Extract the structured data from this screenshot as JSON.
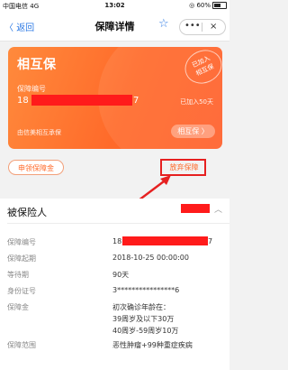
{
  "status": {
    "carrier": "中国电信",
    "network": "4G",
    "time": "13:02",
    "battery_pct": "60%"
  },
  "nav": {
    "back": "返回",
    "title": "保障详情",
    "more": "•••",
    "close": "×"
  },
  "card": {
    "brand": "相互保",
    "stamp": [
      "已加入",
      "相互保"
    ],
    "policy_label": "保障编号",
    "policy_prefix": "18",
    "policy_suffix": "7",
    "joined": "已加入50天",
    "underwriter": "由信美相互承保",
    "button": "相互保 〉"
  },
  "actions": {
    "claim": "申领保障金",
    "give_up": "放弃保障"
  },
  "insured": {
    "title": "被保险人",
    "rows": [
      {
        "label": "保障编号",
        "value_prefix": "18",
        "value_suffix": "7"
      },
      {
        "label": "保障起期",
        "value": "2018-10-25 00:00:00"
      },
      {
        "label": "等待期",
        "value": "90天"
      },
      {
        "label": "身份证号",
        "value": "3****************6"
      },
      {
        "label": "保障金",
        "value_lines": [
          "初次确诊年龄在：",
          "39周岁及以下30万",
          "40周岁-59周岁10万"
        ]
      },
      {
        "label": "保障范围",
        "value": "恶性肿瘤+99种重症疾病"
      }
    ]
  },
  "colors": {
    "accent": "#2f7be5",
    "card_orange": "#ff6a2a",
    "redaction": "#ff1b1b",
    "annotation_red": "#e62020"
  }
}
